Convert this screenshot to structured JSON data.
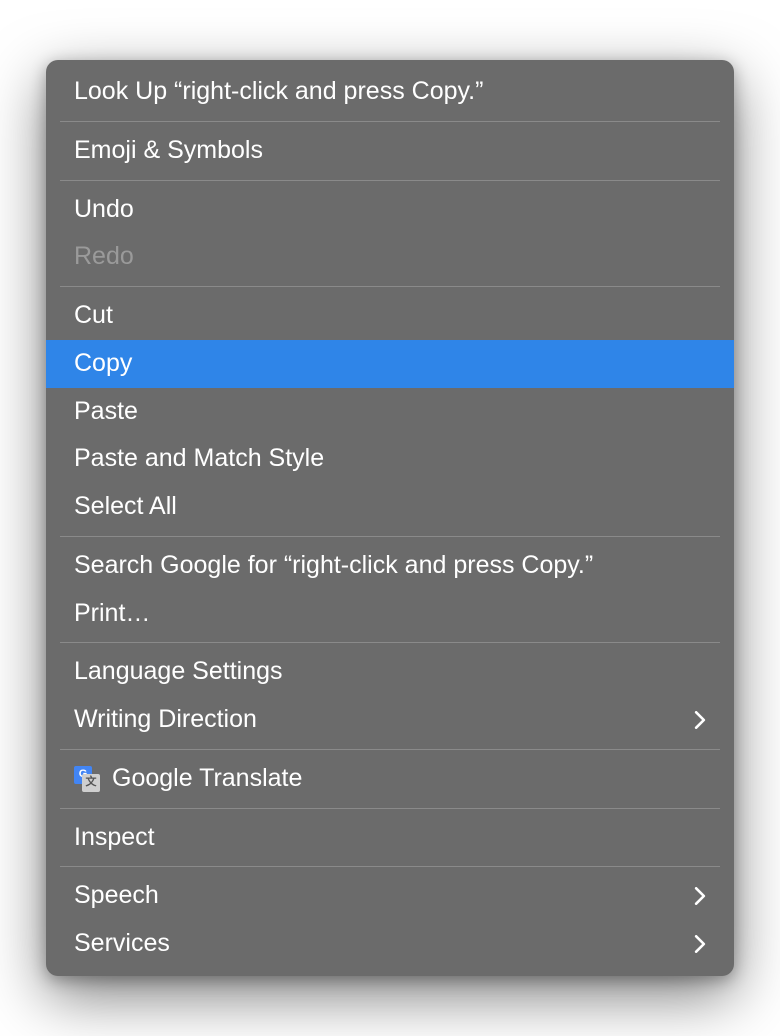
{
  "menu": {
    "lookup": "Look Up “right-click and press Copy.”",
    "emoji_symbols": "Emoji & Symbols",
    "undo": "Undo",
    "redo": "Redo",
    "cut": "Cut",
    "copy": "Copy",
    "paste": "Paste",
    "paste_match": "Paste and Match Style",
    "select_all": "Select All",
    "search_google": "Search Google for “right-click and press Copy.”",
    "print": "Print…",
    "language_settings": "Language Settings",
    "writing_direction": "Writing Direction",
    "google_translate": "Google Translate",
    "inspect": "Inspect",
    "speech": "Speech",
    "services": "Services"
  },
  "state": {
    "highlighted_item": "copy",
    "disabled_items": [
      "redo"
    ]
  },
  "colors": {
    "menu_bg": "#6b6b6b",
    "highlight": "#2f85e8",
    "text": "#ffffff",
    "text_disabled": "#9a9a9a",
    "divider": "#8a8a8a"
  }
}
